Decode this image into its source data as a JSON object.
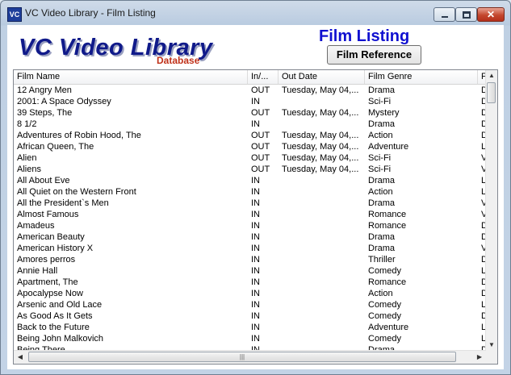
{
  "window": {
    "title": "VC Video Library - Film Listing",
    "icon_text": "VC"
  },
  "header": {
    "logo_text": "VC Video Library",
    "logo_sub": "Database",
    "heading": "Film Listing",
    "film_reference_button": "Film Reference"
  },
  "table": {
    "columns": [
      "Film Name",
      "In/...",
      "Out Date",
      "Film Genre",
      "F"
    ],
    "rows": [
      {
        "name": "12 Angry Men",
        "status": "OUT",
        "out_date": "Tuesday, May 04,...",
        "genre": "Drama",
        "f": "D"
      },
      {
        "name": "2001: A Space Odyssey",
        "status": "IN",
        "out_date": "",
        "genre": "Sci-Fi",
        "f": "D"
      },
      {
        "name": "39 Steps, The",
        "status": "OUT",
        "out_date": "Tuesday, May 04,...",
        "genre": "Mystery",
        "f": "D"
      },
      {
        "name": "8 1/2",
        "status": "IN",
        "out_date": "",
        "genre": "Drama",
        "f": "D"
      },
      {
        "name": "Adventures of Robin Hood, The",
        "status": "OUT",
        "out_date": "Tuesday, May 04,...",
        "genre": "Action",
        "f": "D"
      },
      {
        "name": "African Queen, The",
        "status": "OUT",
        "out_date": "Tuesday, May 04,...",
        "genre": "Adventure",
        "f": "L"
      },
      {
        "name": "Alien",
        "status": "OUT",
        "out_date": "Tuesday, May 04,...",
        "genre": "Sci-Fi",
        "f": "V"
      },
      {
        "name": "Aliens",
        "status": "OUT",
        "out_date": "Tuesday, May 04,...",
        "genre": "Sci-Fi",
        "f": "V"
      },
      {
        "name": "All About Eve",
        "status": "IN",
        "out_date": "",
        "genre": "Drama",
        "f": "L"
      },
      {
        "name": "All Quiet on the Western Front",
        "status": "IN",
        "out_date": "",
        "genre": "Action",
        "f": "L"
      },
      {
        "name": "All the President`s Men",
        "status": "IN",
        "out_date": "",
        "genre": "Drama",
        "f": "V"
      },
      {
        "name": "Almost Famous",
        "status": "IN",
        "out_date": "",
        "genre": "Romance",
        "f": "V"
      },
      {
        "name": "Amadeus",
        "status": "IN",
        "out_date": "",
        "genre": "Romance",
        "f": "D"
      },
      {
        "name": "American Beauty",
        "status": "IN",
        "out_date": "",
        "genre": "Drama",
        "f": "D"
      },
      {
        "name": "American History X",
        "status": "IN",
        "out_date": "",
        "genre": "Drama",
        "f": "V"
      },
      {
        "name": "Amores perros",
        "status": "IN",
        "out_date": "",
        "genre": "Thriller",
        "f": "D"
      },
      {
        "name": "Annie Hall",
        "status": "IN",
        "out_date": "",
        "genre": "Comedy",
        "f": "L"
      },
      {
        "name": "Apartment, The",
        "status": "IN",
        "out_date": "",
        "genre": "Romance",
        "f": "D"
      },
      {
        "name": "Apocalypse Now",
        "status": "IN",
        "out_date": "",
        "genre": "Action",
        "f": "D"
      },
      {
        "name": "Arsenic and Old Lace",
        "status": "IN",
        "out_date": "",
        "genre": "Comedy",
        "f": "L"
      },
      {
        "name": "As Good As It Gets",
        "status": "IN",
        "out_date": "",
        "genre": "Comedy",
        "f": "D"
      },
      {
        "name": "Back to the Future",
        "status": "IN",
        "out_date": "",
        "genre": "Adventure",
        "f": "L"
      },
      {
        "name": "Being John Malkovich",
        "status": "IN",
        "out_date": "",
        "genre": "Comedy",
        "f": "L"
      },
      {
        "name": "Being There",
        "status": "IN",
        "out_date": "",
        "genre": "Drama",
        "f": "D"
      }
    ]
  },
  "scrollbars": {
    "up_arrow": "▲",
    "down_arrow": "▼",
    "left_arrow": "◀",
    "right_arrow": "▶",
    "thumb_grip": "|||"
  }
}
